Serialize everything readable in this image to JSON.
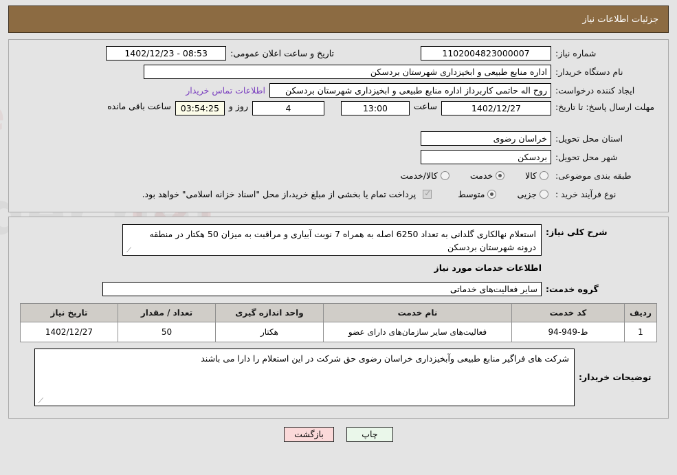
{
  "header": {
    "title": "جزئیات اطلاعات نیاز"
  },
  "fields": {
    "need_number_label": "شماره نیاز:",
    "need_number_value": "1102004823000007",
    "announce_label": "تاریخ و ساعت اعلان عمومی:",
    "announce_value": "08:53 - 1402/12/23",
    "buyer_org_label": "نام دستگاه خریدار:",
    "buyer_org_value": "اداره منابع طبیعی و ابخیزداری شهرستان بردسکن",
    "requester_label": "ایجاد کننده درخواست:",
    "requester_value": "روح اله حاتمی کاربرداز اداره منابع طبیعی و ابخیزداری شهرستان بردسکن",
    "contact_link": "اطلاعات تماس خریدار",
    "deadline_label": "مهلت ارسال پاسخ: تا تاریخ:",
    "deadline_date": "1402/12/27",
    "time_label": "ساعت",
    "deadline_time": "13:00",
    "days_value": "4",
    "days_label": "روز و",
    "countdown_value": "03:54:25",
    "remaining_label": "ساعت باقی مانده",
    "province_label": "استان محل تحویل:",
    "province_value": "خراسان رضوی",
    "city_label": "شهر محل تحویل:",
    "city_value": "بردسکن",
    "category_label": "طبقه بندی موضوعی:",
    "process_label": "نوع فرآیند خرید :",
    "treasury_note": "پرداخت تمام یا بخشی از مبلغ خرید،از محل \"اسناد خزانه اسلامی\" خواهد بود."
  },
  "category_options": [
    {
      "label": "کالا",
      "selected": false
    },
    {
      "label": "خدمت",
      "selected": true
    },
    {
      "label": "کالا/خدمت",
      "selected": false
    }
  ],
  "process_options": [
    {
      "label": "جزیی",
      "selected": false
    },
    {
      "label": "متوسط",
      "selected": true
    }
  ],
  "treasury_checkbox_checked": true,
  "summary": {
    "label": "شرح کلی نیاز:",
    "value": "استعلام نهالکاری گلدانی به تعداد 6250  اصله به همراه 7  نوبت  آبیاری و مراقبت به میزان 50  هکتار در منطقه درونه  شهرستان بردسکن"
  },
  "services_heading": "اطلاعات خدمات مورد نیاز",
  "service_group": {
    "label": "گروه خدمت:",
    "value": "سایر فعالیت‌های خدماتی"
  },
  "table": {
    "columns": [
      "ردیف",
      "کد خدمت",
      "نام خدمت",
      "واحد اندازه گیری",
      "تعداد / مقدار",
      "تاریخ نیاز"
    ],
    "rows": [
      {
        "row": "1",
        "code": "ط-949-94",
        "name": "فعالیت‌های سایر سازمان‌های دارای عضو",
        "unit": "هکتار",
        "qty": "50",
        "date": "1402/12/27"
      }
    ]
  },
  "buyer_notes": {
    "label": "توضیحات خریدار:",
    "value": "شرکت های فراگیر منابع طبیعی وآبخیزداری خراسان رضوی حق شرکت در این استعلام را دارا می باشند"
  },
  "buttons": {
    "print": "چاپ",
    "back": "بازگشت"
  },
  "colors": {
    "header_bg": "#8c6b42",
    "page_bg": "#e4e4e4",
    "link": "#7a3fbf",
    "print_btn": "#eaf7ea",
    "back_btn": "#fbd9d9",
    "table_header": "#d0cdc8"
  }
}
